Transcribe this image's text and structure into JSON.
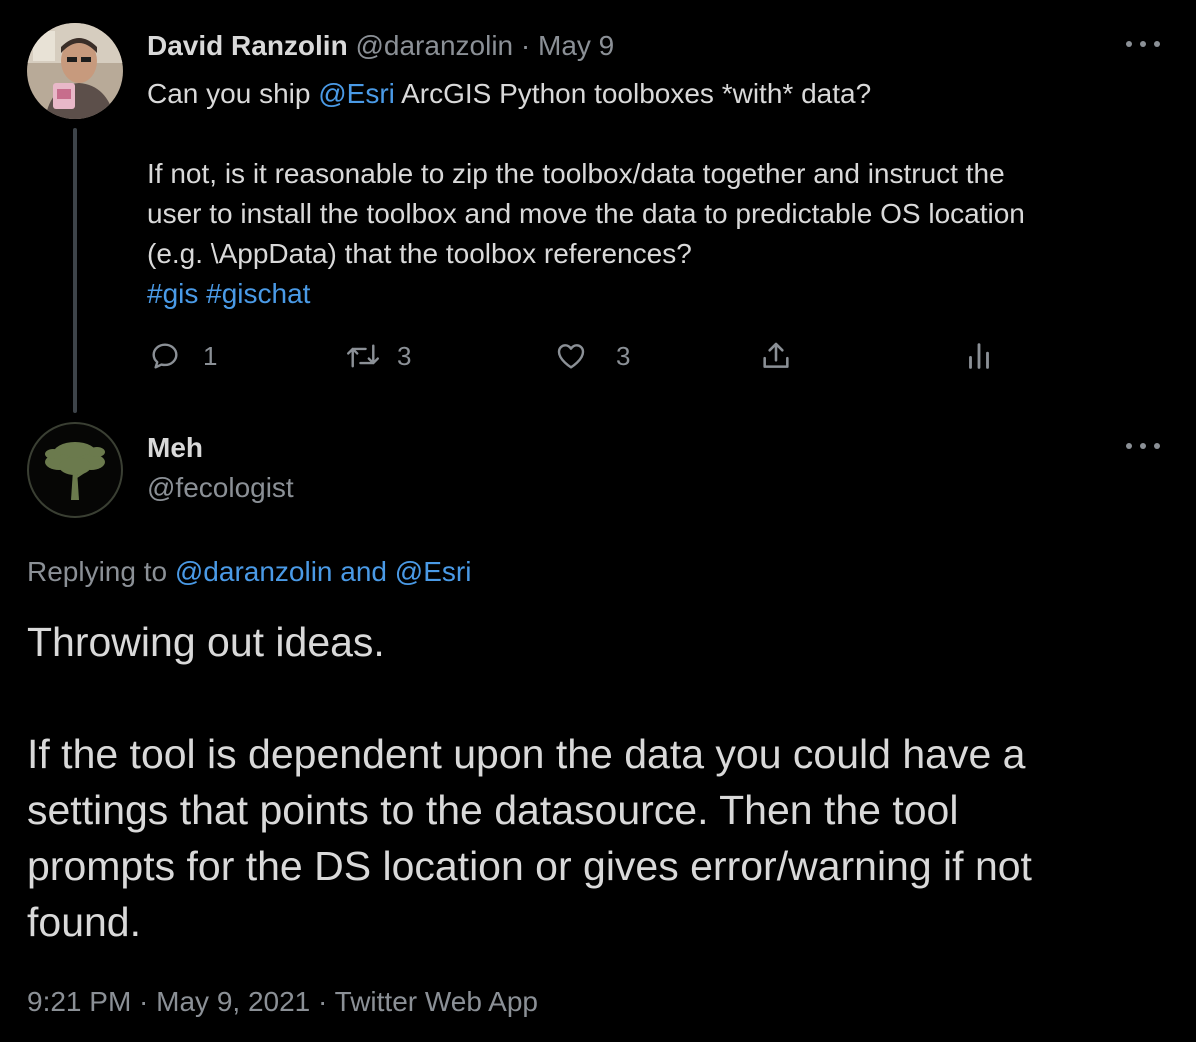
{
  "parent_tweet": {
    "author_name": "David Ranzolin",
    "author_handle": "@daranzolin",
    "separator": " · ",
    "date": "May 9",
    "text_line1_pre": "Can you ship ",
    "text_line1_mention": "@Esri",
    "text_line1_post": " ArcGIS Python toolboxes *with* data?",
    "text_line2": "If not, is it reasonable to zip the toolbox/data together and instruct the",
    "text_line3": "user to install the toolbox and move the data to predictable OS location",
    "text_line4": "(e.g. \\AppData) that the toolbox references?",
    "hashtag1": "#gis",
    "hashtag2": "#gischat",
    "reply_count": "1",
    "retweet_count": "3",
    "like_count": "3",
    "icons": {
      "reply": "reply-icon",
      "retweet": "retweet-icon",
      "like": "heart-icon",
      "share": "share-icon",
      "analytics": "analytics-icon",
      "more": "more-icon"
    }
  },
  "reply_tweet": {
    "author_name": "Meh",
    "author_handle": "@fecologist",
    "replying_prefix": "Replying to ",
    "replying_targets": "@daranzolin and @Esri",
    "text_line1": "Throwing out ideas.",
    "text_line2": "If the tool is dependent upon the data you could have a",
    "text_line3": "settings that points to the datasource. Then the tool",
    "text_line4": "prompts for the DS location or gives error/warning if not",
    "text_line5": "found.",
    "timestamp": "9:21 PM · May 9, 2021 · Twitter Web App"
  },
  "colors": {
    "background": "#000000",
    "text": "#d9d9d9",
    "muted": "#8b9096",
    "link": "#4a9ae6",
    "thread_line": "#3d4349"
  }
}
